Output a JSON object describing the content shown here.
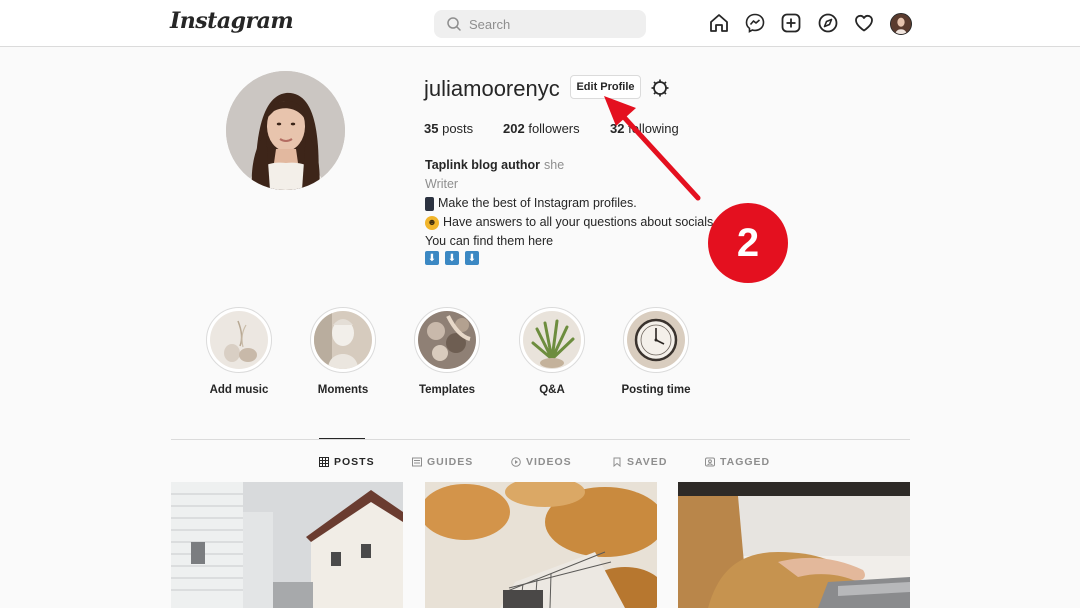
{
  "nav": {
    "logo": "Instagram",
    "search_placeholder": "Search",
    "icons": [
      "home-icon",
      "messenger-icon",
      "new-post-icon",
      "explore-icon",
      "activity-icon",
      "profile-avatar"
    ]
  },
  "profile": {
    "username": "juliamoorenyc",
    "edit_button": "Edit Profile",
    "stats": {
      "posts_count": "35",
      "posts_label": "posts",
      "followers_count": "202",
      "followers_label": "followers",
      "following_count": "32",
      "following_label": "following"
    },
    "bio": {
      "name": "Taplink blog author",
      "pronouns": "she",
      "category": "Writer",
      "line1": "Make the best of Instagram profiles.",
      "line2": "Have answers to all your questions about socials.",
      "line3": "You can find them here",
      "arrows": [
        "⬇",
        "⬇",
        "⬇"
      ]
    }
  },
  "annotation": {
    "step_number": "2",
    "color": "#e4101f"
  },
  "highlights": [
    {
      "label": "Add music"
    },
    {
      "label": "Moments"
    },
    {
      "label": "Templates"
    },
    {
      "label": "Q&A"
    },
    {
      "label": "Posting time"
    }
  ],
  "tabs": [
    {
      "label": "POSTS",
      "active": true
    },
    {
      "label": "GUIDES",
      "active": false
    },
    {
      "label": "VIDEOS",
      "active": false
    },
    {
      "label": "SAVED",
      "active": false
    },
    {
      "label": "TAGGED",
      "active": false
    }
  ]
}
